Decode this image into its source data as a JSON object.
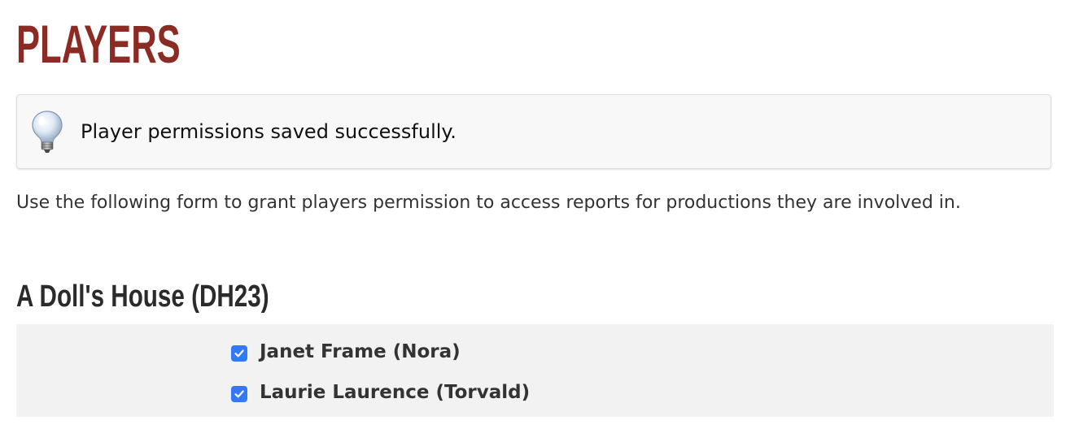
{
  "page": {
    "title": "PLAYERS"
  },
  "notice": {
    "icon": "lightbulb-icon",
    "message": "Player permissions saved successfully."
  },
  "intro": {
    "text": "Use the following form to grant players permission to access reports for productions they are involved in."
  },
  "productions": [
    {
      "title": "A Doll's House (DH23)",
      "players": [
        {
          "label": "Janet Frame (Nora)",
          "checked": true
        },
        {
          "label": "Laurie Laurence (Torvald)",
          "checked": true
        }
      ]
    }
  ],
  "colors": {
    "title": "#8b2b24",
    "checkbox": "#3478f6",
    "panel": "#f2f2f2",
    "notice_bg": "#f8f8f8"
  }
}
